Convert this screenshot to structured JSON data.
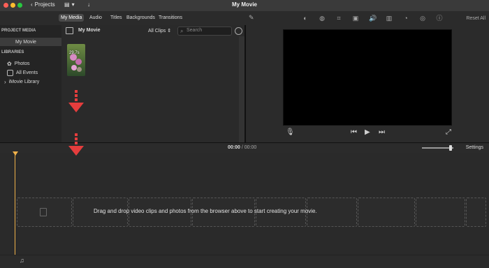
{
  "titlebar": {
    "projects_label": "Projects",
    "title": "My Movie"
  },
  "toolbar2": {
    "tabs": [
      "My Media",
      "Audio",
      "Titles",
      "Backgrounds",
      "Transitions"
    ],
    "reset_all": "Reset All"
  },
  "sidebar": {
    "project_media_header": "PROJECT MEDIA",
    "project_media_item": "My Movie",
    "libraries_header": "LIBRARIES",
    "library_items": [
      "Photos",
      "All Events",
      "iMovie Library"
    ]
  },
  "browser": {
    "title": "My Movie",
    "filter": "All Clips",
    "search_placeholder": "Search",
    "thumb_label": "29.7s"
  },
  "timeline": {
    "time_current": "00:00",
    "time_total": "00:00",
    "settings_label": "Settings",
    "drop_text": "Drag and drop video clips and photos from the browser above to start creating your movie."
  }
}
